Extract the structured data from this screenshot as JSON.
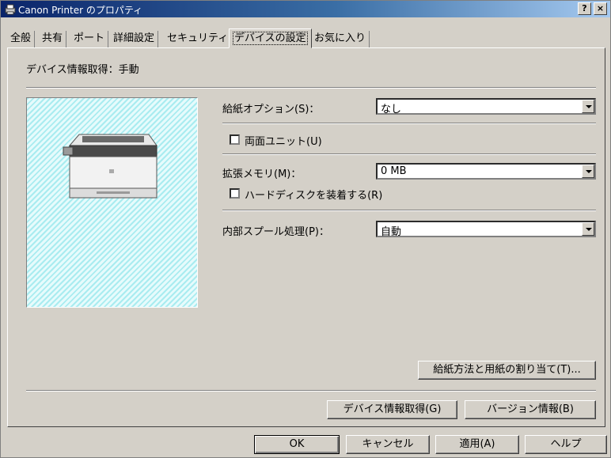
{
  "window": {
    "title": "Canon Printer のプロパティ",
    "help_glyph": "?",
    "close_glyph": "×"
  },
  "tabs": [
    {
      "label": "全般",
      "active": false
    },
    {
      "label": "共有",
      "active": false
    },
    {
      "label": "ポート",
      "active": false
    },
    {
      "label": "詳細設定",
      "active": false
    },
    {
      "label": "セキュリティ",
      "active": false
    },
    {
      "label": "デバイスの設定",
      "active": true
    },
    {
      "label": "お気に入り",
      "active": false
    }
  ],
  "device": {
    "status_text": "デバイス情報取得：手動"
  },
  "settings": {
    "paper_option": {
      "label": "給紙オプション(S)：",
      "value": "なし"
    },
    "duplex_unit": {
      "label": "両面ユニット(U)",
      "checked": false
    },
    "memory": {
      "label": "拡張メモリ(M)：",
      "value": "0 MB"
    },
    "hard_disk": {
      "label": "ハードディスクを装着する(R)",
      "checked": false
    },
    "spool": {
      "label": "内部スプール処理(P)：",
      "value": "自動"
    }
  },
  "buttons": {
    "paper_assign": "給紙方法と用紙の割り当て(T)...",
    "get_device_info": "デバイス情報取得(G)",
    "version_info": "バージョン情報(B)",
    "ok": "OK",
    "cancel": "キャンセル",
    "apply": "適用(A)",
    "help": "ヘルプ"
  }
}
